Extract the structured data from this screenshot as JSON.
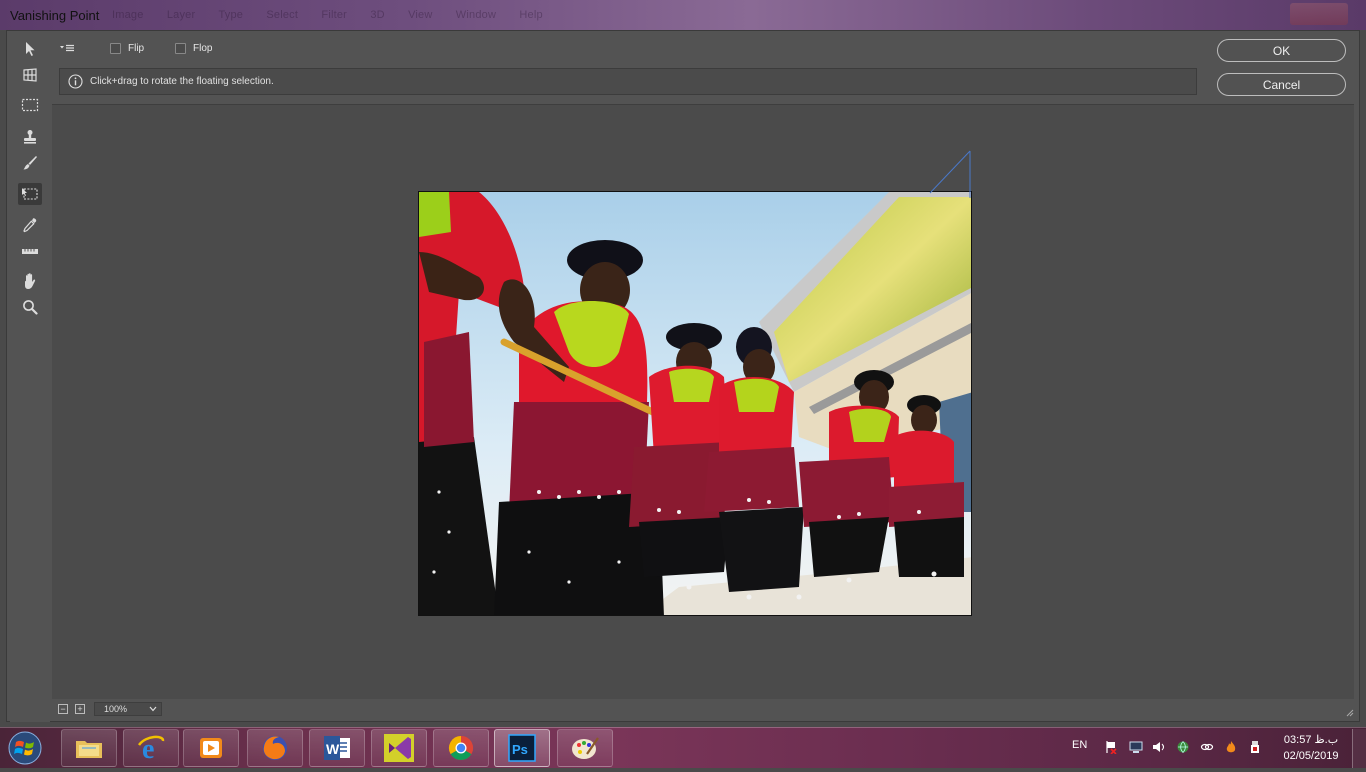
{
  "window": {
    "title": "Vanishing Point",
    "ghost_menu": [
      "Image",
      "Layer",
      "Type",
      "Select",
      "Filter",
      "3D",
      "View",
      "Window",
      "Help"
    ]
  },
  "options": {
    "flip_label": "Flip",
    "flop_label": "Flop",
    "flip_checked": false,
    "flop_checked": false
  },
  "info": {
    "message": "Click+drag to rotate the floating selection."
  },
  "buttons": {
    "ok": "OK",
    "cancel": "Cancel"
  },
  "tools": [
    {
      "name": "edit-plane-tool",
      "icon": "arrow-icon"
    },
    {
      "name": "create-plane-tool",
      "icon": "grid-icon"
    },
    {
      "name": "marquee-tool",
      "icon": "marquee-icon"
    },
    {
      "name": "stamp-tool",
      "icon": "stamp-icon"
    },
    {
      "name": "brush-tool",
      "icon": "brush-icon"
    },
    {
      "name": "transform-tool",
      "icon": "transform-icon",
      "active": true
    },
    {
      "name": "eyedropper-tool",
      "icon": "eyedropper-icon"
    },
    {
      "name": "measure-tool",
      "icon": "ruler-icon"
    },
    {
      "name": "hand-tool",
      "icon": "hand-icon"
    },
    {
      "name": "zoom-tool",
      "icon": "zoom-icon"
    }
  ],
  "zoom": {
    "value": "100%"
  },
  "taskbar": {
    "apps": [
      "file-explorer",
      "internet-explorer",
      "media-player",
      "firefox",
      "word",
      "visual-studio",
      "chrome",
      "photoshop",
      "paint"
    ],
    "active_app": "photoshop",
    "language": "EN",
    "time": "03:57 ب.ظ",
    "date": "02/05/2019"
  },
  "colors": {
    "dialog_bg": "#535353",
    "canvas_bg": "#4b4b4b",
    "selection_line": "#4a78c8"
  }
}
